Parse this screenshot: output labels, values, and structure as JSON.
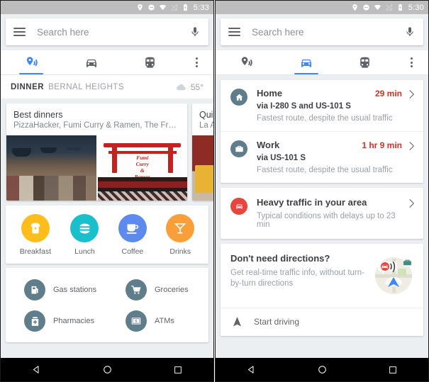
{
  "left": {
    "status": {
      "time": "5:33",
      "icons": [
        "location-pin-icon",
        "do-not-disturb-icon",
        "wifi-icon",
        "signal-off-icon",
        "battery-icon"
      ]
    },
    "search": {
      "placeholder": "Search here",
      "menu_icon": "hamburger-menu-icon",
      "mic_icon": "microphone-icon"
    },
    "tabs": [
      {
        "icon": "explore-pin-icon",
        "name": "explore",
        "active": true
      },
      {
        "icon": "car-icon",
        "name": "driving",
        "active": false
      },
      {
        "icon": "train-icon",
        "name": "transit",
        "active": false
      },
      {
        "icon": "overflow-menu-icon",
        "name": "more",
        "active": false
      }
    ],
    "header": {
      "meal": "DINNER",
      "neighborhood": "BERNAL HEIGHTS",
      "weather_icon": "cloud-icon",
      "temperature": "55°"
    },
    "carousel": [
      {
        "title": "Best dinners",
        "subtitle": "PizzaHacker, Fumi Curry & Ramen, The Front...",
        "sign_text": "Fumi\nCurry\n&\nRamen"
      },
      {
        "title": "Quick",
        "subtitle": "La Alt"
      }
    ],
    "categories": [
      {
        "label": "Breakfast",
        "icon": "bread-icon",
        "color": "#FDBE1C"
      },
      {
        "label": "Lunch",
        "icon": "burger-icon",
        "color": "#19C0CC"
      },
      {
        "label": "Coffee",
        "icon": "coffee-cup-icon",
        "color": "#5C8AEF"
      },
      {
        "label": "Drinks",
        "icon": "cocktail-glass-icon",
        "color": "#F99F3A"
      }
    ],
    "places": [
      {
        "label": "Gas stations",
        "icon": "gas-pump-icon"
      },
      {
        "label": "Groceries",
        "icon": "shopping-cart-icon"
      },
      {
        "label": "Pharmacies",
        "icon": "pharmacy-cross-icon"
      },
      {
        "label": "ATMs",
        "icon": "money-bill-icon"
      }
    ]
  },
  "right": {
    "status": {
      "time": "5:30",
      "icons": [
        "location-pin-icon",
        "do-not-disturb-icon",
        "wifi-icon",
        "signal-off-icon",
        "battery-icon"
      ]
    },
    "search": {
      "placeholder": "Search here",
      "menu_icon": "hamburger-menu-icon",
      "mic_icon": "microphone-icon"
    },
    "tabs": [
      {
        "icon": "explore-pin-icon",
        "name": "explore",
        "active": false
      },
      {
        "icon": "car-icon",
        "name": "driving",
        "active": true
      },
      {
        "icon": "train-icon",
        "name": "transit",
        "active": false
      },
      {
        "icon": "overflow-menu-icon",
        "name": "more",
        "active": false
      }
    ],
    "routes": [
      {
        "name": "Home",
        "icon": "home-icon",
        "time": "29 min",
        "via": "via I-280 S and US-101 S",
        "note": "Fastest route, despite the usual traffic"
      },
      {
        "name": "Work",
        "icon": "briefcase-icon",
        "time": "1 hr 9 min",
        "via": "via US-101 S",
        "note": "Fastest route, despite the usual traffic"
      }
    ],
    "traffic": {
      "icon": "traffic-alert-icon",
      "title": "Heavy traffic in your area",
      "subtitle": "Typical conditions with delays up to 23 min"
    },
    "promo": {
      "title": "Don't need directions?",
      "subtitle": "Get real-time traffic info, without turn-by-turn directions",
      "art_icon": "navigation-map-illustration",
      "start_label": "Start driving",
      "start_icon": "navigation-arrow-icon"
    },
    "accent_red": "#d93025"
  },
  "navbar": {
    "back": "back-triangle-icon",
    "home": "home-circle-icon",
    "recents": "recents-square-icon"
  }
}
